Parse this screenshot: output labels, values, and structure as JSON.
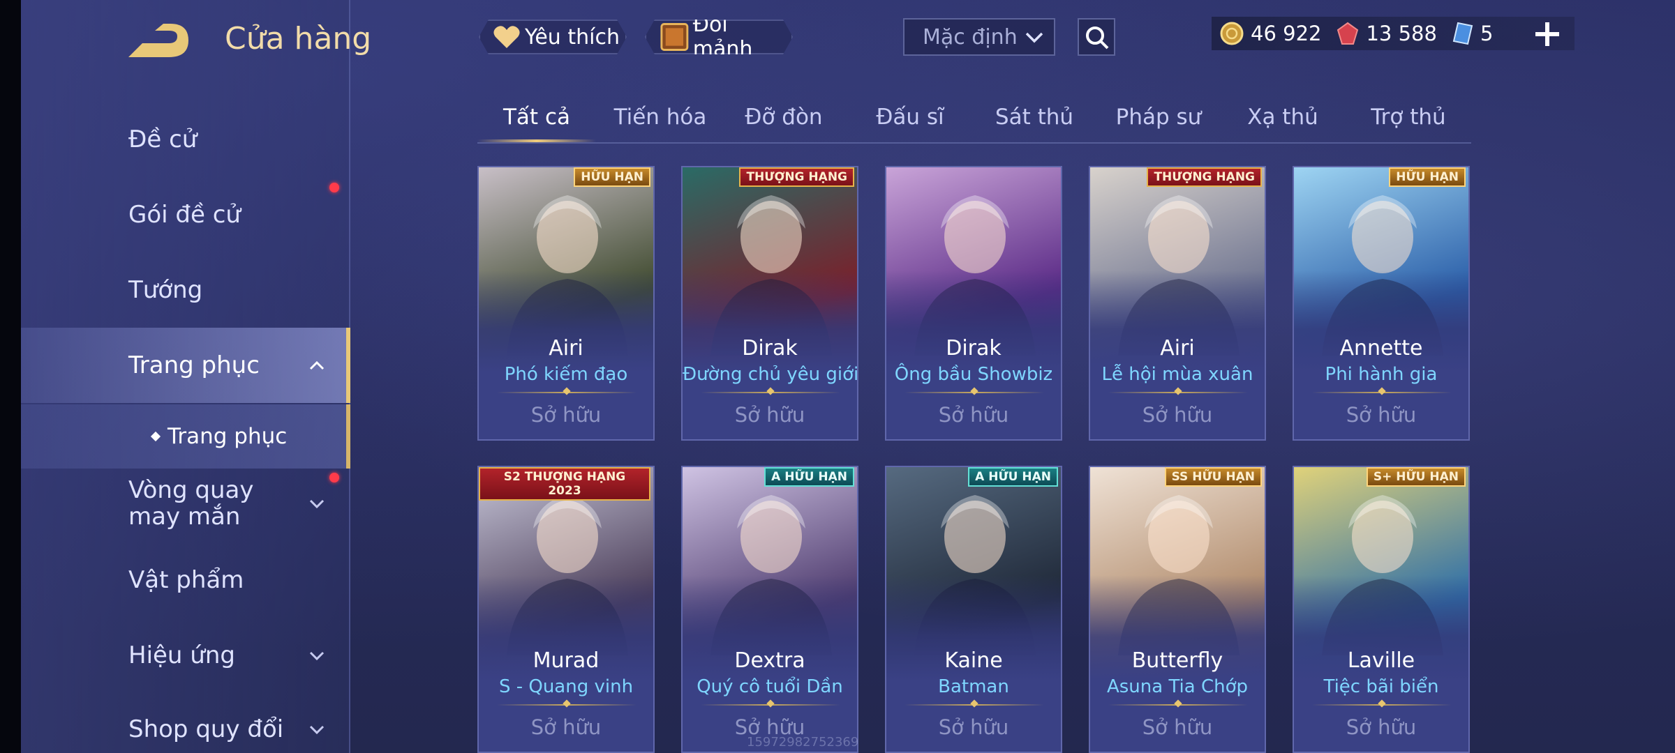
{
  "header": {
    "title": "Cửa hàng",
    "favorite_label": "Yêu thích",
    "exchange_label": "Đổi mảnh",
    "sort_value": "Mặc định"
  },
  "currency": [
    {
      "icon": "gold-coin-icon",
      "value": "46 922"
    },
    {
      "icon": "ruby-icon",
      "value": "13 588"
    },
    {
      "icon": "voucher-icon",
      "value": "5"
    }
  ],
  "sidebar": {
    "items": [
      {
        "label": "Đề cử"
      },
      {
        "label": "Gói đề cử"
      },
      {
        "label": "Tướng"
      },
      {
        "label": "Trang phục"
      },
      {
        "label": "Vòng quay may mắn"
      },
      {
        "label": "Vật phẩm"
      },
      {
        "label": "Hiệu ứng"
      },
      {
        "label": "Shop quy đổi"
      }
    ],
    "sub_item": "Trang phục"
  },
  "tabs": [
    "Tất cả",
    "Tiến hóa",
    "Đỡ đòn",
    "Đấu sĩ",
    "Sát thủ",
    "Pháp sư",
    "Xạ thủ",
    "Trợ thủ"
  ],
  "cards": [
    {
      "hero": "Airi",
      "skin": "Phó kiếm đạo",
      "status": "Sở hữu",
      "badge": "HỮU HẠN",
      "art": [
        "#3f4a2e",
        "#c8bfc7"
      ]
    },
    {
      "hero": "Dirak",
      "skin": "Đường chủ yêu giới",
      "status": "Sở hữu",
      "badge": "THƯỢNG HẠNG",
      "art": [
        "#7b1f2a",
        "#2a6b66"
      ]
    },
    {
      "hero": "Dirak",
      "skin": "Ông bầu Showbiz",
      "status": "Sở hữu",
      "badge": "",
      "art": [
        "#5a2a86",
        "#c9a4d8"
      ]
    },
    {
      "hero": "Airi",
      "skin": "Lễ hội mùa xuân",
      "status": "Sở hữu",
      "badge": "THƯỢNG HẠNG",
      "art": [
        "#6d7390",
        "#d8d2cc"
      ]
    },
    {
      "hero": "Annette",
      "skin": "Phi hành gia",
      "status": "Sở hữu",
      "badge": "HỮU HẠN",
      "art": [
        "#2a5ea8",
        "#9ed4f2"
      ]
    },
    {
      "hero": "Murad",
      "skin": "S - Quang vinh",
      "status": "Sở hữu",
      "badge": "S2 THƯỢNG HẠNG 2023",
      "art": [
        "#4a3c58",
        "#c7c6d8"
      ]
    },
    {
      "hero": "Dextra",
      "skin": "Quý cô tuổi Dần",
      "status": "Sở hữu",
      "badge": "A HỮU HẠN",
      "art": [
        "#4e3b6e",
        "#cfc3e3"
      ]
    },
    {
      "hero": "Kaine",
      "skin": "Batman",
      "status": "Sở hữu",
      "badge": "A HỮU HẠN",
      "art": [
        "#1f2838",
        "#566a80"
      ]
    },
    {
      "hero": "Butterfly",
      "skin": "Asuna Tia Chớp",
      "status": "Sở hữu",
      "badge": "SS HỮU HẠN",
      "art": [
        "#b08a6a",
        "#efe2d6"
      ]
    },
    {
      "hero": "Laville",
      "skin": "Tiệc bãi biển",
      "status": "Sở hữu",
      "badge": "S+ HỮU HẠN",
      "art": [
        "#2e6fa8",
        "#e0d27a"
      ]
    }
  ],
  "watermark": "15972982752369"
}
